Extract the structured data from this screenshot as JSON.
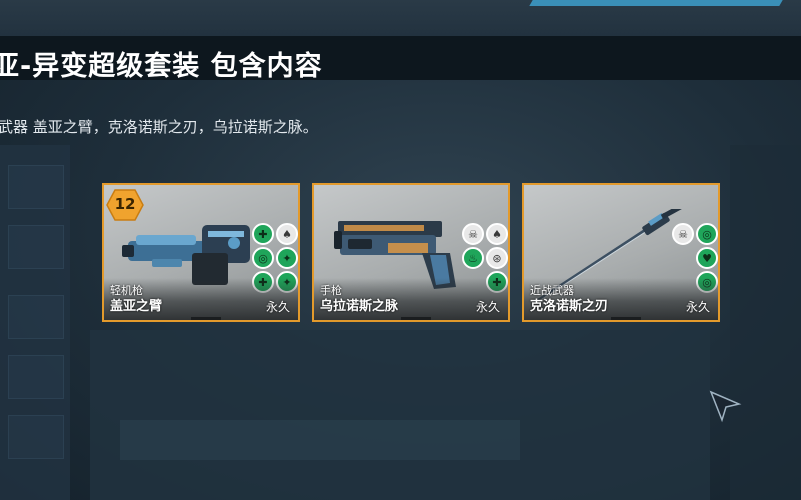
{
  "title": "亚-异变超级套装 包含内容",
  "description": "武器 盖亚之臂，克洛诺斯之刃，乌拉诺斯之脉。",
  "cards": [
    {
      "level": "12",
      "type": "轻机枪",
      "name": "盖亚之臂",
      "duration": "永久",
      "attributes": [
        "crosshair-icon",
        "spade-icon",
        "target-icon",
        "gun-icon",
        "crosshair-icon",
        "gun-icon"
      ]
    },
    {
      "level": "",
      "type": "手枪",
      "name": "乌拉诺斯之脉",
      "duration": "永久",
      "attributes": [
        "skull-icon",
        "spade-icon",
        "flame-icon",
        "swirl-icon",
        "crosshair-icon"
      ]
    },
    {
      "level": "",
      "type": "近战武器",
      "name": "克洛诺斯之刃",
      "duration": "永久",
      "attributes": [
        "skull-icon",
        "target-icon",
        "heart-icon",
        "target-icon"
      ]
    }
  ],
  "colors": {
    "card_border": "#e39a2c",
    "attr_green": "#1fa55a",
    "level_badge": "#f0a32e"
  }
}
